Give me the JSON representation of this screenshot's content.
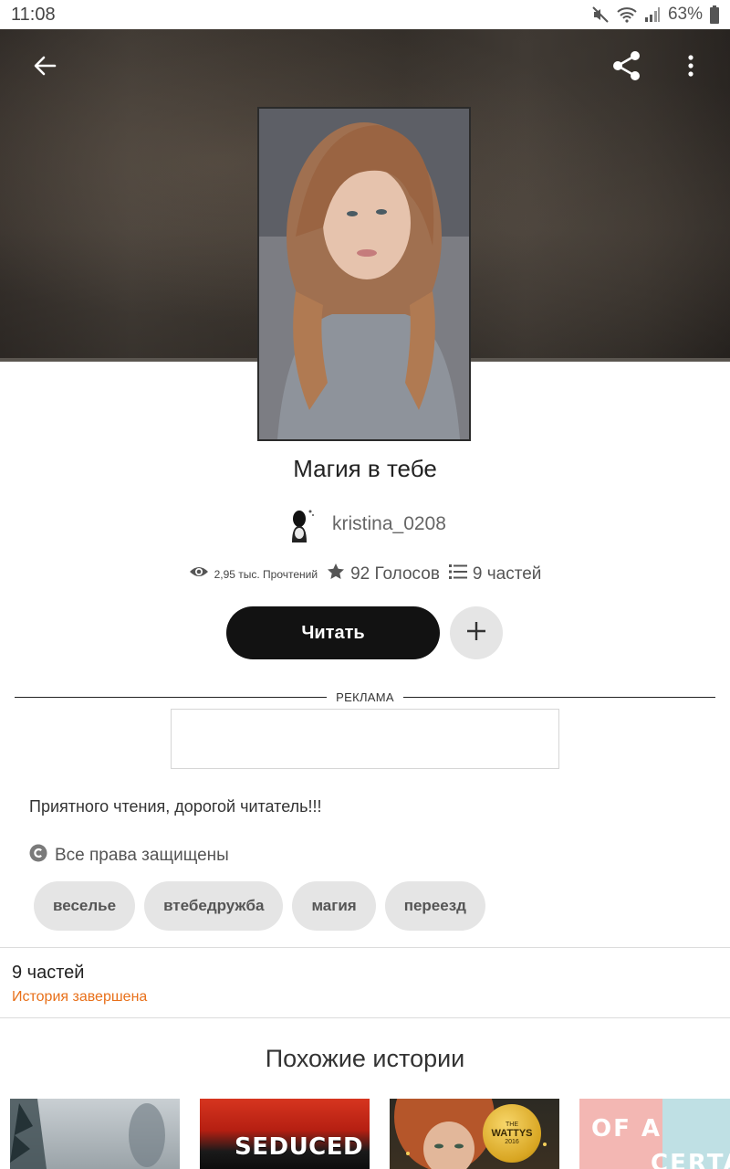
{
  "status_bar": {
    "time": "11:08",
    "battery": "63%"
  },
  "book": {
    "title": "Магия в тебе",
    "author": "kristina_0208",
    "reads": "2,95 тыс. Прочтений",
    "votes": "92 Голосов",
    "parts": "9 частей",
    "read_button": "Читать",
    "ad_label": "РЕКЛАМА",
    "description": "Приятного чтения, дорогой читатель!!!",
    "rights": "Все права защищены",
    "tags": [
      "веселье",
      "втебедружба",
      "магия",
      "переезд"
    ],
    "parts_summary": {
      "count": "9 частей",
      "status": "История завершена"
    }
  },
  "similar": {
    "title": "Похожие истории",
    "items": [
      {
        "title": ""
      },
      {
        "title": "SEDUCED"
      },
      {
        "title": "",
        "badge_top": "THE",
        "badge": "WATTYS",
        "badge_year": "2016"
      },
      {
        "title": "OF A",
        "title2": "CERTAIN"
      }
    ]
  },
  "colors": {
    "accent_orange": "#e8701a",
    "button_dark": "#121212",
    "tag_bg": "#e5e5e5"
  },
  "icons": [
    "back-arrow-icon",
    "share-icon",
    "more-vert-icon",
    "eye-icon",
    "star-icon",
    "list-icon",
    "plus-icon",
    "copyright-icon"
  ]
}
